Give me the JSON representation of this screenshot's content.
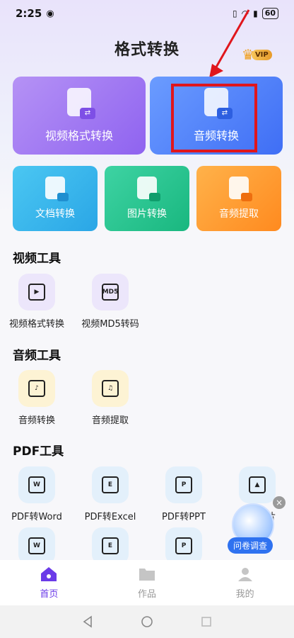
{
  "status": {
    "time": "2:25",
    "battery": "60"
  },
  "header": {
    "title": "格式转换",
    "vip": "VIP"
  },
  "main_cards": [
    {
      "label": "视频格式转换"
    },
    {
      "label": "音频转换"
    }
  ],
  "small_cards": [
    {
      "label": "文档转换"
    },
    {
      "label": "图片转换"
    },
    {
      "label": "音频提取"
    }
  ],
  "sections": {
    "video": {
      "title": "视频工具",
      "tools": [
        {
          "label": "视频格式转换"
        },
        {
          "label": "视频MD5转码",
          "icon_text": "MD5"
        }
      ]
    },
    "audio": {
      "title": "音频工具",
      "tools": [
        {
          "label": "音频转换"
        },
        {
          "label": "音频提取"
        }
      ]
    },
    "pdf": {
      "title": "PDF工具",
      "tools": [
        {
          "label": "PDF转Word",
          "icon_text": "W"
        },
        {
          "label": "PDF转Excel",
          "icon_text": "E"
        },
        {
          "label": "PDF转PPT",
          "icon_text": "P"
        },
        {
          "label": "片"
        }
      ],
      "tools_row2": [
        {
          "icon_text": "W"
        },
        {
          "icon_text": "E"
        },
        {
          "icon_text": "P"
        }
      ]
    }
  },
  "floating_ad": {
    "label": "问卷调查",
    "close": "×"
  },
  "bottom_nav": [
    {
      "label": "首页"
    },
    {
      "label": "作品"
    },
    {
      "label": "我的"
    }
  ]
}
